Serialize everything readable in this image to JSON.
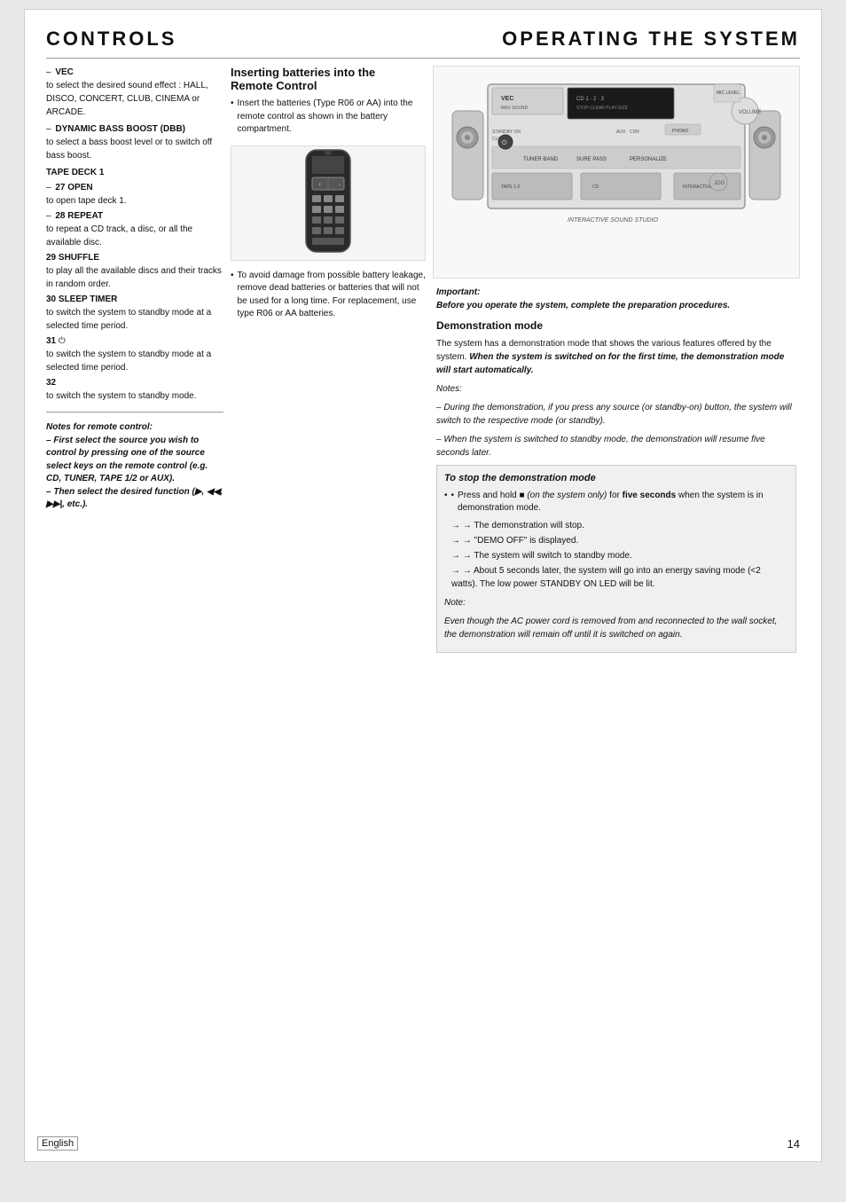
{
  "header": {
    "left_title": "CONTROLS",
    "right_title": "OPERATING THE SYSTEM"
  },
  "controls": {
    "items": [
      {
        "id": "VEC",
        "label": "VEC",
        "desc": "to select the desired sound effect : HALL, DISCO, CONCERT, CLUB, CINEMA or ARCADE."
      },
      {
        "id": "DBB",
        "label": "DYNAMIC BASS BOOST (DBB)",
        "desc": "to select a bass boost level or to switch off bass boost."
      },
      {
        "id": "TAPE_DECK_1",
        "label": "TAPE DECK 1",
        "desc": ""
      },
      {
        "id": "OPEN",
        "label": "OPEN",
        "desc": "to open tape deck 1."
      },
      {
        "id": "REPEAT",
        "label": "REPEAT",
        "desc": "to repeat a CD track, a disc, or all the available disc."
      },
      {
        "id": "SHUFFLE",
        "label": "SHUFFLE",
        "desc": "to play all the available discs and their tracks in random order."
      },
      {
        "id": "SLEEP_TIMER",
        "label": "SLEEP TIMER",
        "desc": "to switch the system to standby mode at a selected time period."
      },
      {
        "id": "STANDBY",
        "label": "⏻",
        "desc": "to switch the system to standby mode."
      }
    ],
    "item_numbers": [
      {
        "num": "27",
        "label": ""
      },
      {
        "num": "28",
        "label": ""
      },
      {
        "num": "29",
        "label": ""
      },
      {
        "num": "30",
        "label": ""
      },
      {
        "num": "31",
        "label": ""
      },
      {
        "num": "32",
        "label": ""
      }
    ]
  },
  "notes_remote": {
    "heading": "Notes for remote control:",
    "note1": "– First select the source you wish to control by pressing one of the source select keys on the remote control (e.g. CD, TUNER, TAPE 1/2 or AUX).",
    "note2": "– Then select the desired function (▶, ◀◀, ▶▶, etc.)."
  },
  "batteries": {
    "heading": "Inserting batteries into the",
    "subheading": "Remote Control",
    "bullet1": "Insert the batteries (Type R06 or AA) into the remote control as shown in the battery compartment.",
    "bullet2": "To avoid damage from possible battery leakage, remove dead batteries or batteries that will not be used for a long time. For replacement, use type R06 or AA batteries."
  },
  "demonstration": {
    "heading": "Demonstration mode",
    "body": "The system has a demonstration mode that shows the various features offered by the system.",
    "highlight": "When the system is switched on for the first time, the demonstration mode will start automatically.",
    "important_label": "Important:",
    "important_text": "Before you operate the system, complete the preparation procedures.",
    "notes_label": "Notes:",
    "note1": "– During the demonstration, if you press any source (or standby-on) button, the system will switch to the respective mode (or standby).",
    "note2": "– When the system is switched to standby mode, the demonstration will resume five seconds later."
  },
  "stop_demo": {
    "heading": "To stop the demonstration mode",
    "bullet": "Press and hold ■ (on the system only) for five seconds when the system is in demonstration mode.",
    "arrow1": "The demonstration will stop.",
    "arrow2": "\"DEMO OFF\" is displayed.",
    "arrow3": "The system will switch to standby mode.",
    "arrow4": "About 5 seconds later, the system will go into an energy saving mode (<2 watts). The low power STANDBY ON LED will be lit.",
    "note_label": "Note:",
    "note1": "Even though the AC power cord is removed from and reconnected to the wall socket, the demonstration will remain off until it is switched on again."
  },
  "footer": {
    "language": "English",
    "page_number": "14"
  }
}
